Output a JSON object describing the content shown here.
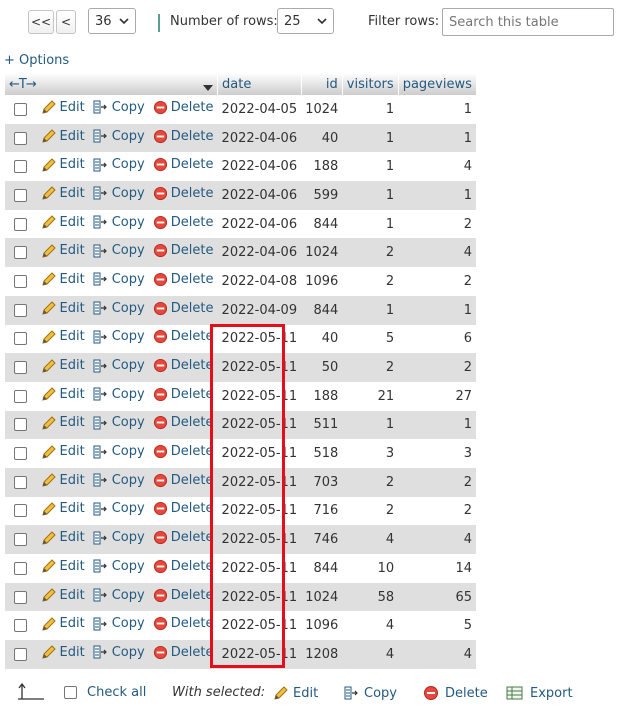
{
  "nav": {
    "first_label": "<<",
    "prev_label": "<",
    "page_value": "36",
    "rows_label": "Number of rows:",
    "rows_value": "25",
    "filter_label": "Filter rows:",
    "search_placeholder": "Search this table"
  },
  "options_label": "+ Options",
  "table": {
    "columns": [
      "date",
      "id",
      "visitors",
      "pageviews"
    ],
    "actions": {
      "edit": "Edit",
      "copy": "Copy",
      "delete": "Delete"
    },
    "rows": [
      [
        "2022-04-05",
        "1024",
        "1",
        "1"
      ],
      [
        "2022-04-06",
        "40",
        "1",
        "1"
      ],
      [
        "2022-04-06",
        "188",
        "1",
        "4"
      ],
      [
        "2022-04-06",
        "599",
        "1",
        "1"
      ],
      [
        "2022-04-06",
        "844",
        "1",
        "2"
      ],
      [
        "2022-04-06",
        "1024",
        "2",
        "4"
      ],
      [
        "2022-04-08",
        "1096",
        "2",
        "2"
      ],
      [
        "2022-04-09",
        "844",
        "1",
        "1"
      ],
      [
        "2022-05-11",
        "40",
        "5",
        "6"
      ],
      [
        "2022-05-11",
        "50",
        "2",
        "2"
      ],
      [
        "2022-05-11",
        "188",
        "21",
        "27"
      ],
      [
        "2022-05-11",
        "511",
        "1",
        "1"
      ],
      [
        "2022-05-11",
        "518",
        "3",
        "3"
      ],
      [
        "2022-05-11",
        "703",
        "2",
        "2"
      ],
      [
        "2022-05-11",
        "716",
        "2",
        "2"
      ],
      [
        "2022-05-11",
        "746",
        "4",
        "4"
      ],
      [
        "2022-05-11",
        "844",
        "10",
        "14"
      ],
      [
        "2022-05-11",
        "1024",
        "58",
        "65"
      ],
      [
        "2022-05-11",
        "1096",
        "4",
        "5"
      ],
      [
        "2022-05-11",
        "1208",
        "4",
        "4"
      ]
    ]
  },
  "bottom": {
    "check_all": "Check all",
    "with_selected": "With selected:",
    "edit": "Edit",
    "copy": "Copy",
    "delete": "Delete",
    "export": "Export"
  },
  "colors": {
    "link": "#235a81",
    "row_even": "#dfdfdf",
    "highlight": "#e3101c"
  }
}
